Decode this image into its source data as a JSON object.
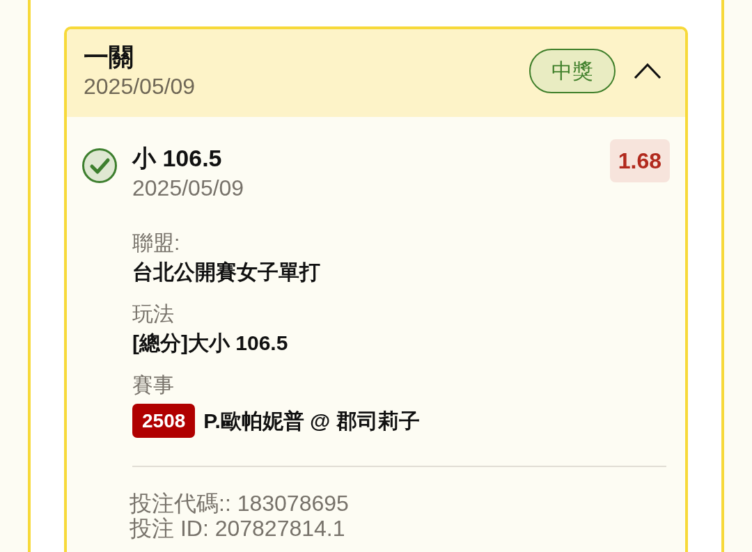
{
  "bet": {
    "title": "一關",
    "date": "2025/05/09",
    "status": {
      "kind": "won",
      "label": "中獎"
    },
    "expanded": true,
    "selection": {
      "won": true,
      "pick": "小 106.5",
      "date": "2025/05/09",
      "odds": "1.68"
    },
    "fields": [
      {
        "kind": "text",
        "label": "聯盟:",
        "value": "台北公開賽女子單打"
      },
      {
        "kind": "text",
        "label": "玩法",
        "value": "[總分]大小 106.5"
      },
      {
        "kind": "match",
        "label": "賽事",
        "match_no": "2508",
        "value": "P.歐帕妮普 @ 郡司莉子"
      }
    ],
    "footer": [
      "投注代碼:: 183078695",
      "投注 ID: 207827814.1"
    ]
  }
}
